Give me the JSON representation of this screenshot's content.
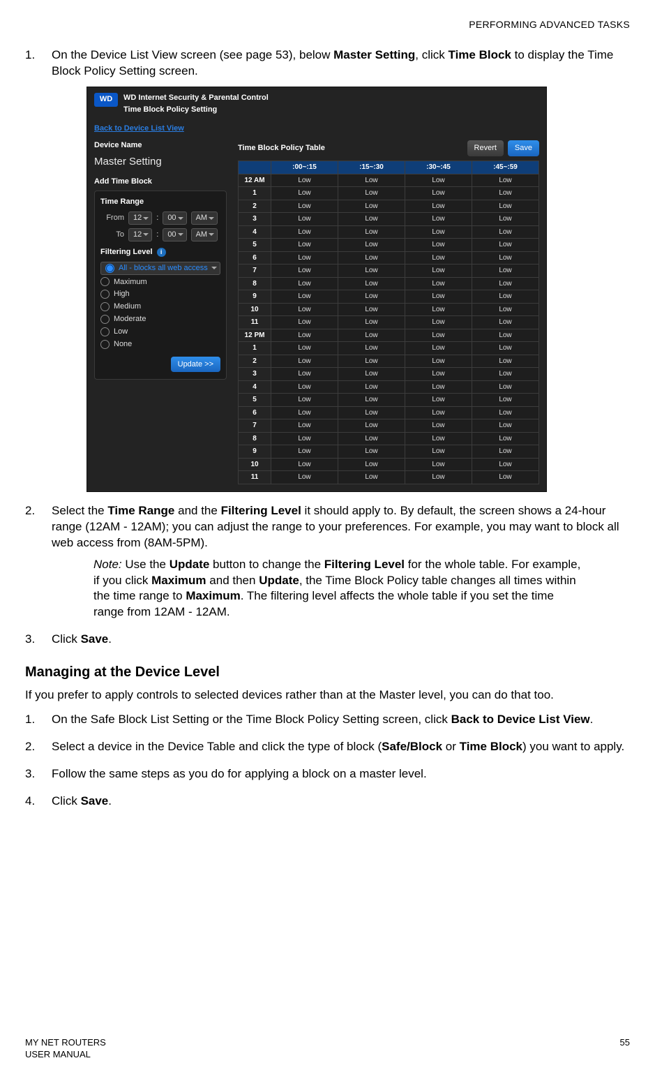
{
  "running_head": "PERFORMING ADVANCED TASKS",
  "step1": {
    "num": "1.",
    "pre": "On the Device List View screen (see page 53), below ",
    "b1": "Master Setting",
    "mid": ", click ",
    "b2": "Time Block",
    "post": " to display the Time Block Policy Setting screen."
  },
  "shot": {
    "wd": "WD",
    "title1": "WD Internet Security & Parental Control",
    "title2": "Time Block Policy Setting",
    "backlink": "Back to Device List View",
    "device_name_label": "Device Name",
    "device_name_value": "Master Setting",
    "add_time_block": "Add Time Block",
    "time_range_label": "Time Range",
    "from_label": "From",
    "to_label": "To",
    "hour_sel": "12",
    "min_sel": "00",
    "ampm_sel": "AM",
    "filtering_level_label": "Filtering Level",
    "info_glyph": "i",
    "levels": [
      {
        "label": "All - blocks all web access",
        "selected": true
      },
      {
        "label": "Maximum",
        "selected": false
      },
      {
        "label": "High",
        "selected": false
      },
      {
        "label": "Medium",
        "selected": false
      },
      {
        "label": "Moderate",
        "selected": false
      },
      {
        "label": "Low",
        "selected": false
      },
      {
        "label": "None",
        "selected": false
      }
    ],
    "update_btn": "Update >>",
    "table_title": "Time Block Policy Table",
    "revert_btn": "Revert",
    "save_btn": "Save",
    "cols": [
      ":00~:15",
      ":15~:30",
      ":30~:45",
      ":45~:59"
    ],
    "hours": [
      "12 AM",
      "1",
      "2",
      "3",
      "4",
      "5",
      "6",
      "7",
      "8",
      "9",
      "10",
      "11",
      "12 PM",
      "1",
      "2",
      "3",
      "4",
      "5",
      "6",
      "7",
      "8",
      "9",
      "10",
      "11"
    ],
    "cell": "Low"
  },
  "step2": {
    "num": "2.",
    "pre": "Select the ",
    "b1": "Time Range",
    "mid1": " and the ",
    "b2": "Filtering Level",
    "post": " it should apply to. By default, the screen shows a 24-hour range (12AM - 12AM); you can adjust the range to your preferences. For example, you may want to block all web access from (8AM-5PM)."
  },
  "note": {
    "label": "Note:",
    "pre": "  Use the ",
    "b1": "Update",
    "mid1": " button to change the ",
    "b2": "Filtering Level",
    "mid2": " for the whole table. For example, if you click ",
    "b3": "Maximum",
    "mid3": " and then ",
    "b4": "Update",
    "mid4": ", the Time Block Policy table changes all times within the time range to ",
    "b5": "Maximum",
    "post": ". The filtering level affects the whole table if you set the time range from 12AM - 12AM."
  },
  "step3": {
    "num": "3.",
    "pre": "Click ",
    "b1": "Save",
    "post": "."
  },
  "section_heading": "Managing at the Device Level",
  "intro": "If you prefer to apply controls to selected devices rather than at the Master level, you can do that too.",
  "dstep1": {
    "num": "1.",
    "pre": "On the Safe Block List Setting or the Time Block Policy Setting screen, click ",
    "b1": "Back to Device List View",
    "post": "."
  },
  "dstep2": {
    "num": "2.",
    "pre": "Select a device in the Device Table and click the type of block (",
    "b1": "Safe/Block",
    "mid": " or ",
    "b2": "Time Block",
    "post": ") you want to apply."
  },
  "dstep3": {
    "num": "3.",
    "text": "Follow the same steps as you do for applying a block on a master level."
  },
  "dstep4": {
    "num": "4.",
    "pre": "Click ",
    "b1": "Save",
    "post": "."
  },
  "footer": {
    "left1": "MY NET ROUTERS",
    "left2": "USER MANUAL",
    "page": "55"
  }
}
